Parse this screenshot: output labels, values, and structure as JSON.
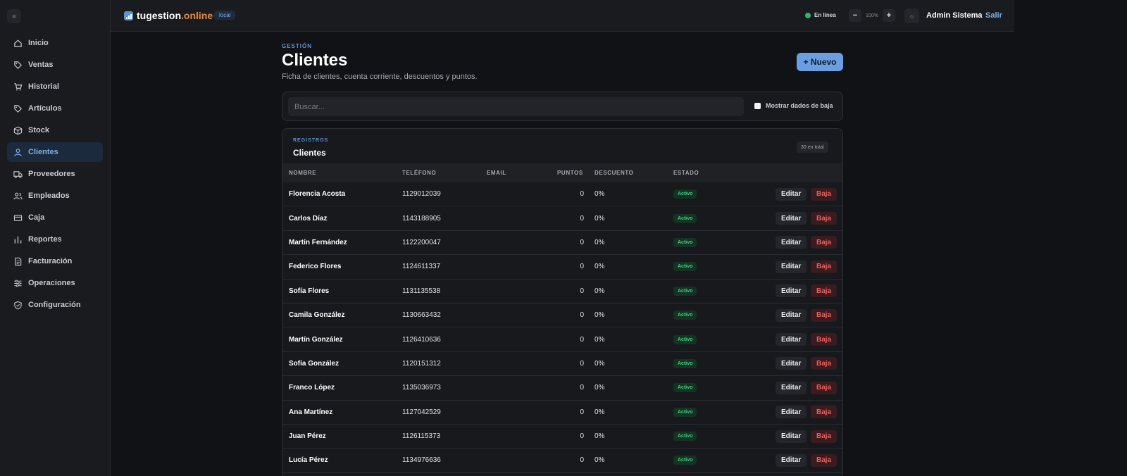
{
  "sidebar": {
    "collapse_icon": "≡",
    "items": [
      {
        "label": "Inicio",
        "icon": "home-icon",
        "active": false
      },
      {
        "label": "Ventas",
        "icon": "tag-icon",
        "active": false
      },
      {
        "label": "Historial",
        "icon": "cart-icon",
        "active": false
      },
      {
        "label": "Artículos",
        "icon": "tag-icon",
        "active": false
      },
      {
        "label": "Stock",
        "icon": "box-icon",
        "active": false
      },
      {
        "label": "Clientes",
        "icon": "user-icon",
        "active": true
      },
      {
        "label": "Proveedores",
        "icon": "truck-icon",
        "active": false
      },
      {
        "label": "Empleados",
        "icon": "users-icon",
        "active": false
      },
      {
        "label": "Caja",
        "icon": "card-icon",
        "active": false
      },
      {
        "label": "Reportes",
        "icon": "bar-chart-icon",
        "active": false
      },
      {
        "label": "Facturación",
        "icon": "document-icon",
        "active": false
      },
      {
        "label": "Operaciones",
        "icon": "sliders-icon",
        "active": false
      },
      {
        "label": "Configuración",
        "icon": "shield-icon",
        "active": false
      }
    ]
  },
  "topbar": {
    "logo_main": "tugestion",
    "logo_suffix": ".online",
    "env_badge": "local",
    "status": "En línea",
    "zoom_minus": "−",
    "zoom_value": "100%",
    "zoom_plus": "+",
    "theme_icon": "☼",
    "user_name": "Admin Sistema",
    "logout": "Salir"
  },
  "page": {
    "eyebrow": "GESTIÓN",
    "title": "Clientes",
    "subtitle": "Ficha de clientes, cuenta corriente, descuentos y puntos.",
    "new_button": "+ Nuevo"
  },
  "search": {
    "placeholder": "Buscar...",
    "show_inactive_label": "Mostrar dados de baja"
  },
  "table": {
    "eyebrow": "REGISTROS",
    "title": "Clientes",
    "total": "30 en total",
    "columns": {
      "name": "NOMBRE",
      "phone": "TELÉFONO",
      "email": "EMAIL",
      "points": "PUNTOS",
      "discount": "DESCUENTO",
      "state": "ESTADO"
    },
    "edit_label": "Editar",
    "delete_label": "Baja",
    "rows": [
      {
        "name": "Florencia Acosta",
        "phone": "1129012039",
        "email": "",
        "points": "0",
        "discount": "0%",
        "state": "Activo"
      },
      {
        "name": "Carlos Díaz",
        "phone": "1143188905",
        "email": "",
        "points": "0",
        "discount": "0%",
        "state": "Activo"
      },
      {
        "name": "Martín Fernández",
        "phone": "1122200047",
        "email": "",
        "points": "0",
        "discount": "0%",
        "state": "Activo"
      },
      {
        "name": "Federico Flores",
        "phone": "1124611337",
        "email": "",
        "points": "0",
        "discount": "0%",
        "state": "Activo"
      },
      {
        "name": "Sofía Flores",
        "phone": "1131135538",
        "email": "",
        "points": "0",
        "discount": "0%",
        "state": "Activo"
      },
      {
        "name": "Camila González",
        "phone": "1130663432",
        "email": "",
        "points": "0",
        "discount": "0%",
        "state": "Activo"
      },
      {
        "name": "Martín González",
        "phone": "1126410636",
        "email": "",
        "points": "0",
        "discount": "0%",
        "state": "Activo"
      },
      {
        "name": "Sofía González",
        "phone": "1120151312",
        "email": "",
        "points": "0",
        "discount": "0%",
        "state": "Activo"
      },
      {
        "name": "Franco López",
        "phone": "1135036973",
        "email": "",
        "points": "0",
        "discount": "0%",
        "state": "Activo"
      },
      {
        "name": "Ana Martínez",
        "phone": "1127042529",
        "email": "",
        "points": "0",
        "discount": "0%",
        "state": "Activo"
      },
      {
        "name": "Juan Pérez",
        "phone": "1126115373",
        "email": "",
        "points": "0",
        "discount": "0%",
        "state": "Activo"
      },
      {
        "name": "Lucía Pérez",
        "phone": "1134976636",
        "email": "",
        "points": "0",
        "discount": "0%",
        "state": "Activo"
      }
    ]
  }
}
